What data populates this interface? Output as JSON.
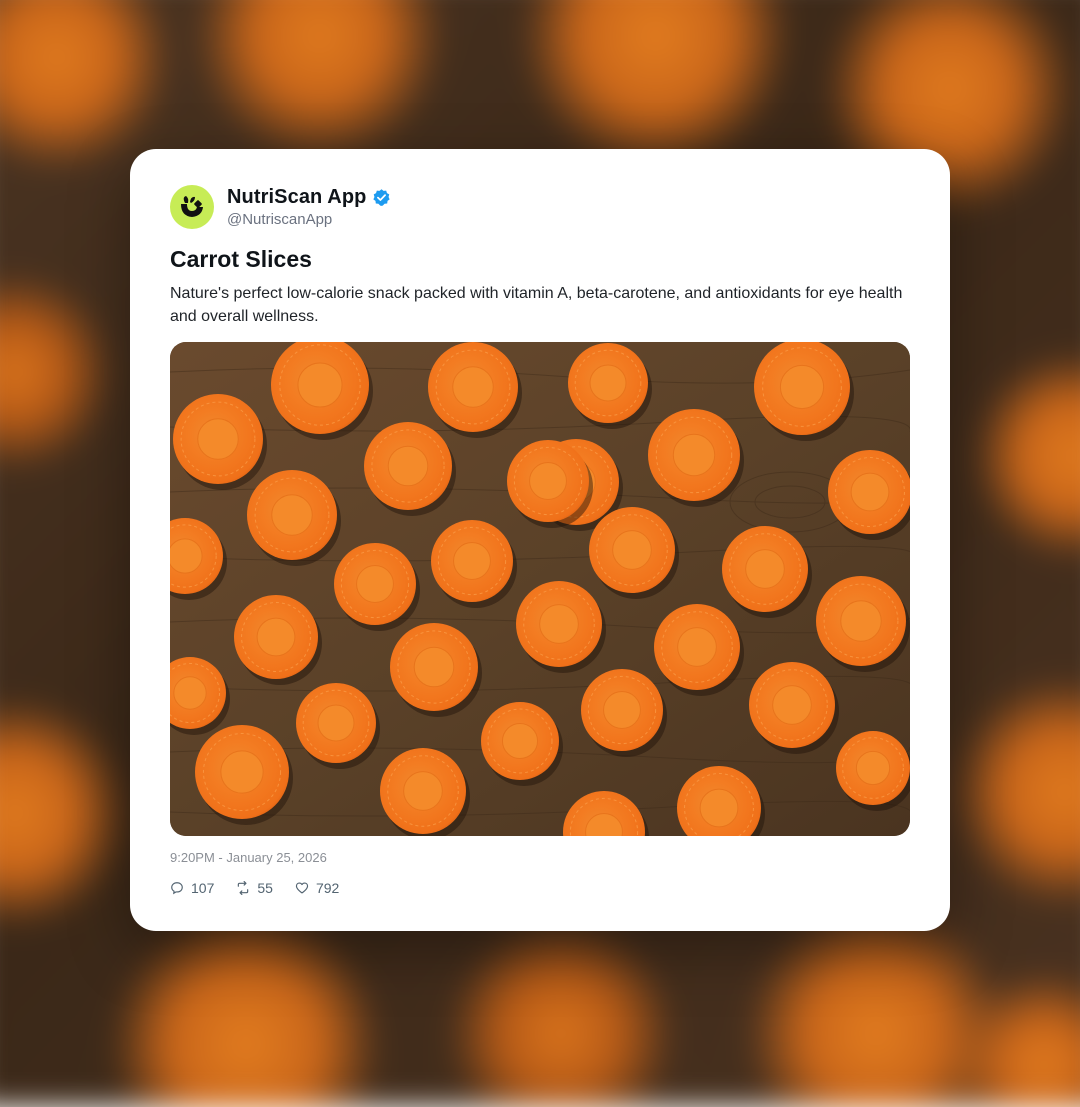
{
  "post": {
    "author": {
      "display_name": "NutriScan App",
      "handle": "@NutriscanApp",
      "verified": true,
      "avatar_color": "#c7ec56",
      "verified_color": "#1d9bf0"
    },
    "title": "Carrot Slices",
    "body": "Nature's perfect low-calorie snack packed with vitamin A, beta-carotene, and antioxidants for eye health and overall wellness.",
    "image": {
      "icon": "carrot-slices-photo",
      "wood_color": "#5a4128",
      "carrot_color": "#f07a22"
    },
    "timestamp": "9:20PM - January 25, 2026",
    "stats": {
      "replies": "107",
      "reposts": "55",
      "likes": "792"
    }
  }
}
